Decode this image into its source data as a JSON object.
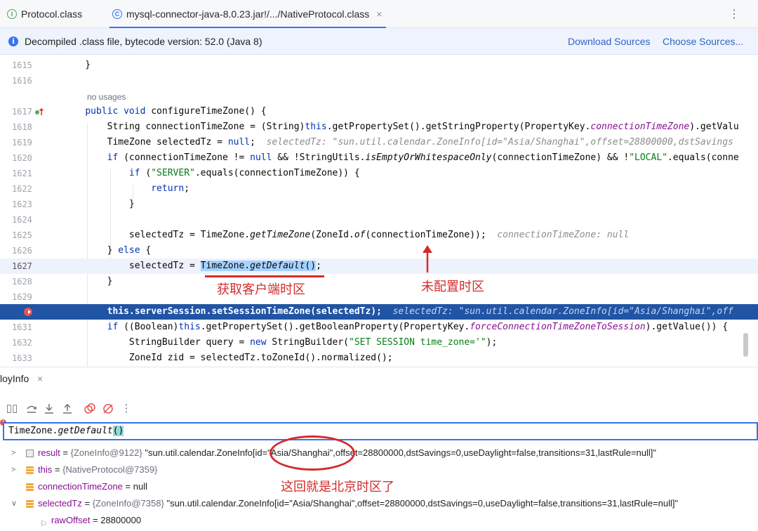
{
  "tabs": [
    {
      "label": "Protocol.class",
      "icon": "interface-icon"
    },
    {
      "label": "mysql-connector-java-8.0.23.jar!/.../NativeProtocol.class",
      "icon": "class-icon",
      "active": true
    }
  ],
  "banner": {
    "text": "Decompiled .class file, bytecode version: 52.0 (Java 8)",
    "download_sources": "Download Sources",
    "choose_sources": "Choose Sources..."
  },
  "editor": {
    "no_usages": "no usages",
    "lines": [
      {
        "num": "1615",
        "code": "    }"
      },
      {
        "num": "1616",
        "code": ""
      },
      {
        "num": "1617",
        "code": "    public void configureTimeZone() {"
      },
      {
        "num": "1618",
        "code": "        String connectionTimeZone = (String)this.getPropertySet().getStringProperty(PropertyKey.connectionTimeZone).getValu"
      },
      {
        "num": "1619",
        "code": "        TimeZone selectedTz = null;"
      },
      {
        "num": "1619h",
        "code": "selectedTz: \"sun.util.calendar.ZoneInfo[id=\"Asia/Shanghai\",offset=28800000,dstSavings"
      },
      {
        "num": "1620",
        "code": "        if (connectionTimeZone != null && !StringUtils.isEmptyOrWhitespaceOnly(connectionTimeZone) && !\"LOCAL\".equals(conne"
      },
      {
        "num": "1621",
        "code": "            if (\"SERVER\".equals(connectionTimeZone)) {"
      },
      {
        "num": "1622",
        "code": "                return;"
      },
      {
        "num": "1623",
        "code": "            }"
      },
      {
        "num": "1624",
        "code": ""
      },
      {
        "num": "1625",
        "code": "            selectedTz = TimeZone.getTimeZone(ZoneId.of(connectionTimeZone));"
      },
      {
        "num": "1625h",
        "code": "connectionTimeZone: null"
      },
      {
        "num": "1626",
        "code": "        } else {"
      },
      {
        "num": "1627",
        "code": "            selectedTz = TimeZone.getDefault();"
      },
      {
        "num": "1628",
        "code": "        }"
      },
      {
        "num": "1629",
        "code": ""
      },
      {
        "num": "1630",
        "code": "        this.serverSession.setSessionTimeZone(selectedTz);"
      },
      {
        "num": "1630h",
        "code": "selectedTz: \"sun.util.calendar.ZoneInfo[id=\"Asia/Shanghai\",off"
      },
      {
        "num": "1631",
        "code": "        if ((Boolean)this.getPropertySet().getBooleanProperty(PropertyKey.forceConnectionTimeZoneToSession).getValue()) {"
      },
      {
        "num": "1632",
        "code": "            StringBuilder query = new StringBuilder(\"SET SESSION time_zone='\");"
      },
      {
        "num": "1633",
        "code": "            ZoneId zid = selectedTz.toZoneId().normalized();"
      }
    ],
    "annotations": {
      "get_default": "获取客户端时区",
      "not_configured": "未配置时区"
    }
  },
  "debug": {
    "tab_label": "loyInfo",
    "expression": "TimeZone.getDefault()",
    "variables": [
      {
        "name": "result",
        "type": "{ZoneInfo@9122}",
        "value": "\"sun.util.calendar.ZoneInfo[id=\"Asia/Shanghai\",offset=28800000,dstSavings=0,useDaylight=false,transitions=31,lastRule=null]\""
      },
      {
        "name": "this",
        "type": "{NativeProtocol@7359}",
        "value": ""
      },
      {
        "name": "connectionTimeZone",
        "type": "",
        "value": "null"
      },
      {
        "name": "selectedTz",
        "type": "{ZoneInfo@7358}",
        "value": "\"sun.util.calendar.ZoneInfo[id=\"Asia/Shanghai\",offset=28800000,dstSavings=0,useDaylight=false,transitions=31,lastRule=null]\""
      },
      {
        "name": "rawOffset",
        "type": "",
        "value": "28800000"
      }
    ],
    "annotation": "这回就是北京时区了"
  },
  "colors": {
    "accent": "#3574f0",
    "annotation_red": "#d42c2c",
    "exec_line": "#2154a4"
  }
}
